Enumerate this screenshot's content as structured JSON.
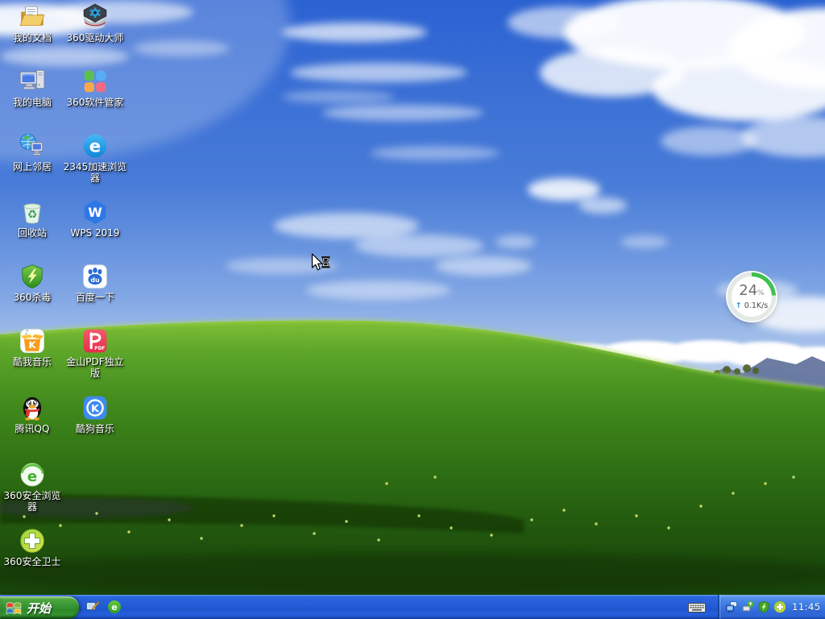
{
  "desktop": {
    "column1": [
      {
        "icon": "my-documents-icon",
        "label": "我的文档"
      },
      {
        "icon": "my-computer-icon",
        "label": "我的电脑"
      },
      {
        "icon": "network-places-icon",
        "label": "网上邻居"
      },
      {
        "icon": "recycle-bin-icon",
        "label": "回收站"
      },
      {
        "icon": "360-antivirus-shield-icon",
        "label": "360杀毒"
      },
      {
        "icon": "kuwo-music-icon",
        "label": "酷我音乐"
      },
      {
        "icon": "tencent-qq-penguin-icon",
        "label": "腾讯QQ"
      },
      {
        "icon": "360-safe-browser-icon",
        "label": "360安全浏览器"
      },
      {
        "icon": "360-safety-guard-icon",
        "label": "360安全卫士"
      }
    ],
    "column2": [
      {
        "icon": "360-driver-master-icon",
        "label": "360驱动大师"
      },
      {
        "icon": "360-software-manager-icon",
        "label": "360软件管家"
      },
      {
        "icon": "2345-browser-icon",
        "label": "2345加速浏览器"
      },
      {
        "icon": "wps-2019-icon",
        "label": "WPS 2019"
      },
      {
        "icon": "baidu-paw-icon",
        "label": "百度一下"
      },
      {
        "icon": "kingsoft-pdf-icon",
        "label": "金山PDF独立版"
      },
      {
        "icon": "kugou-music-icon",
        "label": "酷狗音乐"
      }
    ]
  },
  "widget": {
    "percent": "24",
    "percent_unit": "%",
    "arrow": "↑",
    "speed": "0.1K/s",
    "ring_color": "#3ec14d"
  },
  "taskbar": {
    "start_label": "开始",
    "clock": "11:45",
    "quick_launch": [
      {
        "icon": "show-desktop-icon"
      },
      {
        "icon": "360-browser-quick-icon"
      }
    ],
    "input_indicator": {
      "icon": "keyboard-icon"
    },
    "tray_icons": [
      {
        "icon": "network-connection-icon"
      },
      {
        "icon": "usb-device-icon"
      },
      {
        "icon": "antivirus-shield-tray-icon"
      },
      {
        "icon": "360-guard-tray-icon"
      }
    ]
  },
  "glyphs": {
    "e_2345": "e",
    "w_wps": "W",
    "k_kuwo": "K",
    "k_kugou": "K",
    "du_baidu": "du",
    "pdf": "PDF",
    "recycle": "♻",
    "note": "♪",
    "e_360": "e"
  },
  "colors": {
    "taskbar_blue": "#245cd6",
    "start_green": "#389735",
    "sky_blue": "#2b62d2",
    "grass_green": "#41891c"
  }
}
